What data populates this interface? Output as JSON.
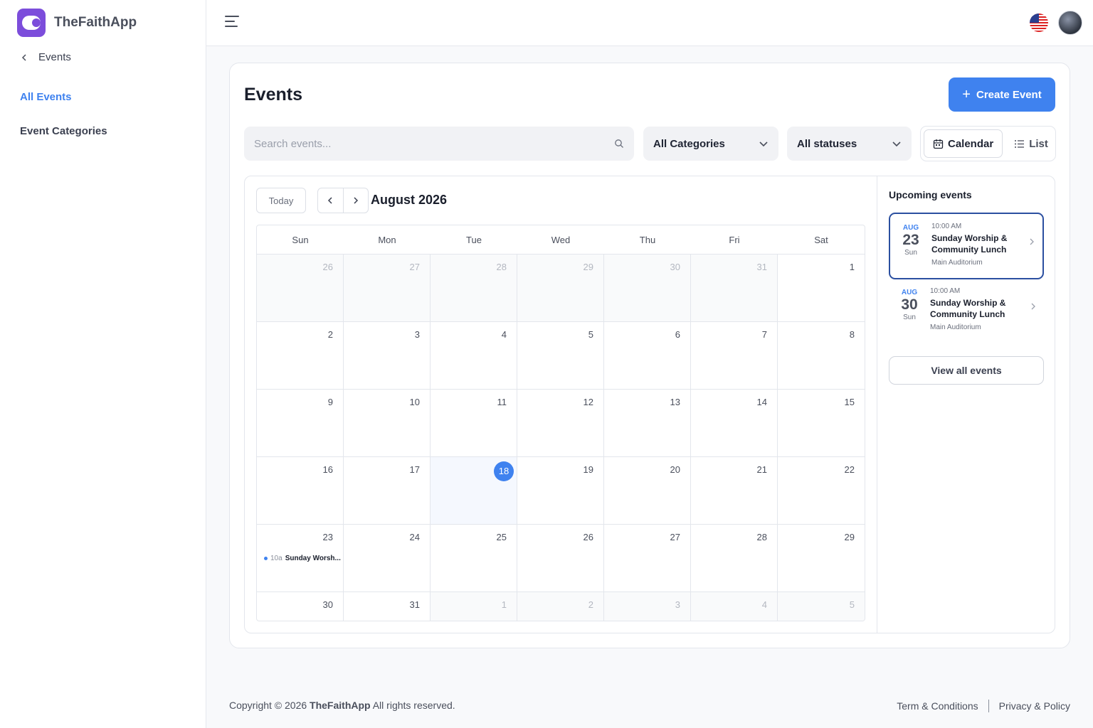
{
  "brand": {
    "name": "TheFaithApp"
  },
  "sidebar": {
    "back_label": "Events",
    "items": [
      {
        "label": "All Events",
        "active": true
      },
      {
        "label": "Event Categories",
        "active": false
      }
    ]
  },
  "header": {
    "language_flag": "us-flag-icon",
    "avatar": "user-avatar"
  },
  "main": {
    "title": "Events",
    "create_button": "Create Event",
    "search_placeholder": "Search events...",
    "category_filter": "All Categories",
    "status_filter": "All statuses",
    "view_calendar": "Calendar",
    "view_list": "List",
    "active_view": "Calendar"
  },
  "calendar": {
    "today_label": "Today",
    "month_title": "August 2026",
    "weekdays": [
      "Sun",
      "Mon",
      "Tue",
      "Wed",
      "Thu",
      "Fri",
      "Sat"
    ],
    "today": 18,
    "weeks": [
      [
        {
          "d": "26",
          "m": true
        },
        {
          "d": "27",
          "m": true
        },
        {
          "d": "28",
          "m": true
        },
        {
          "d": "29",
          "m": true
        },
        {
          "d": "30",
          "m": true
        },
        {
          "d": "31",
          "m": true
        },
        {
          "d": "1"
        }
      ],
      [
        {
          "d": "2"
        },
        {
          "d": "3"
        },
        {
          "d": "4"
        },
        {
          "d": "5"
        },
        {
          "d": "6"
        },
        {
          "d": "7"
        },
        {
          "d": "8"
        }
      ],
      [
        {
          "d": "9"
        },
        {
          "d": "10"
        },
        {
          "d": "11"
        },
        {
          "d": "12"
        },
        {
          "d": "13"
        },
        {
          "d": "14"
        },
        {
          "d": "15"
        }
      ],
      [
        {
          "d": "16"
        },
        {
          "d": "17"
        },
        {
          "d": "18",
          "today": true
        },
        {
          "d": "19"
        },
        {
          "d": "20"
        },
        {
          "d": "21"
        },
        {
          "d": "22"
        }
      ],
      [
        {
          "d": "23",
          "event": {
            "time": "10a",
            "name": "Sunday Worsh..."
          }
        },
        {
          "d": "24"
        },
        {
          "d": "25"
        },
        {
          "d": "26"
        },
        {
          "d": "27"
        },
        {
          "d": "28"
        },
        {
          "d": "29"
        }
      ],
      [
        {
          "d": "30"
        },
        {
          "d": "31"
        },
        {
          "d": "1",
          "m": true
        },
        {
          "d": "2",
          "m": true
        },
        {
          "d": "3",
          "m": true
        },
        {
          "d": "4",
          "m": true
        },
        {
          "d": "5",
          "m": true
        }
      ]
    ]
  },
  "upcoming": {
    "title": "Upcoming events",
    "events": [
      {
        "month": "AUG",
        "day": "23",
        "weekday": "Sun",
        "time": "10:00 AM",
        "name": "Sunday Worship & Community Lunch",
        "location": "Main Auditorium",
        "selected": true
      },
      {
        "month": "AUG",
        "day": "30",
        "weekday": "Sun",
        "time": "10:00 AM",
        "name": "Sunday Worship & Community Lunch",
        "location": "Main Auditorium",
        "selected": false
      }
    ],
    "view_all": "View all events"
  },
  "footer": {
    "copyright_prefix": "Copyright © 2026",
    "brand": "TheFaithApp",
    "copyright_suffix": "All rights reserved.",
    "terms": "Term & Conditions",
    "privacy": "Privacy & Policy"
  },
  "colors": {
    "accent": "#3f82ef",
    "brand": "#7c4ddb",
    "selected_border": "#2b4fa0"
  }
}
